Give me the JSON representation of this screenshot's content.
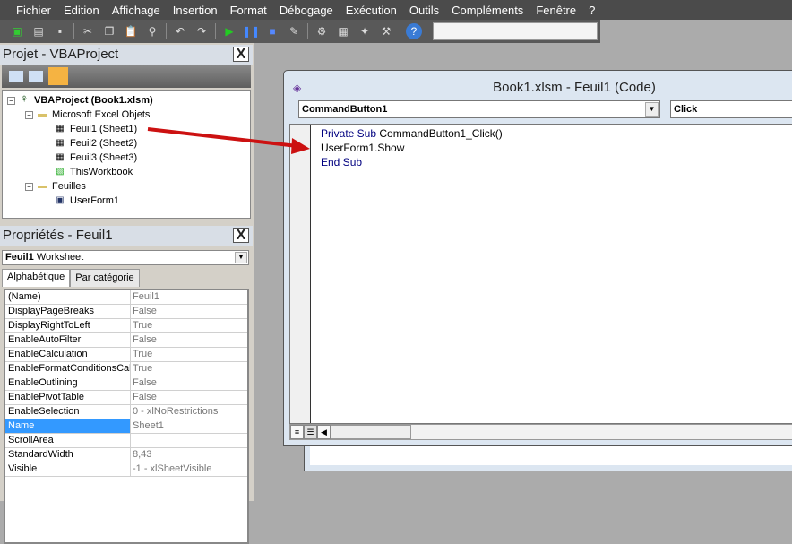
{
  "menu": [
    "Fichier",
    "Edition",
    "Affichage",
    "Insertion",
    "Format",
    "Débogage",
    "Exécution",
    "Outils",
    "Compléments",
    "Fenêtre",
    "?"
  ],
  "toolbar_icons": [
    "excel-icon",
    "insert-form-icon",
    "save-icon",
    "cut-icon",
    "copy-icon",
    "paste-icon",
    "find-icon",
    "undo-icon",
    "redo-icon",
    "run-icon",
    "pause-icon",
    "stop-icon",
    "design-mode-icon",
    "project-explorer-icon",
    "properties-icon",
    "object-browser-icon",
    "toolbox-icon",
    "help-icon"
  ],
  "project": {
    "title": "Projet - VBAProject",
    "close": "X",
    "tree": [
      {
        "label": "VBAProject (Book1.xlsm)",
        "level": 0,
        "bold": true,
        "toggle": "−",
        "icon": "vba-project-icon"
      },
      {
        "label": "Microsoft Excel Objets",
        "level": 1,
        "toggle": "−",
        "icon": "folder-icon"
      },
      {
        "label": "Feuil1 (Sheet1)",
        "level": 2,
        "icon": "sheet-icon"
      },
      {
        "label": "Feuil2 (Sheet2)",
        "level": 2,
        "icon": "sheet-icon"
      },
      {
        "label": "Feuil3 (Sheet3)",
        "level": 2,
        "icon": "sheet-icon"
      },
      {
        "label": "ThisWorkbook",
        "level": 2,
        "icon": "workbook-icon"
      },
      {
        "label": "Feuilles",
        "level": 1,
        "toggle": "−",
        "icon": "folder-icon"
      },
      {
        "label": "UserForm1",
        "level": 2,
        "icon": "userform-icon"
      }
    ]
  },
  "properties": {
    "title": "Propriétés - Feuil1",
    "close": "X",
    "object_name": "Feuil1",
    "object_type": "Worksheet",
    "tabs": [
      "Alphabétique",
      "Par catégorie"
    ],
    "rows": [
      [
        "(Name)",
        "Feuil1"
      ],
      [
        "DisplayPageBreaks",
        "False"
      ],
      [
        "DisplayRightToLeft",
        "True"
      ],
      [
        "EnableAutoFilter",
        "False"
      ],
      [
        "EnableCalculation",
        "True"
      ],
      [
        "EnableFormatConditionsCalculation",
        "True"
      ],
      [
        "EnableOutlining",
        "False"
      ],
      [
        "EnablePivotTable",
        "False"
      ],
      [
        "EnableSelection",
        "0 - xlNoRestrictions"
      ],
      [
        "Name",
        "Sheet1"
      ],
      [
        "ScrollArea",
        ""
      ],
      [
        "StandardWidth",
        "8,43"
      ],
      [
        "Visible",
        "-1 - xlSheetVisible"
      ]
    ],
    "selected_row": "Name"
  },
  "code_window": {
    "title": "Book1.xlsm - Feuil1 (Code)",
    "object_combo": "CommandButton1",
    "proc_combo": "Click",
    "lines": [
      {
        "kw": "Private Sub",
        "rest": " CommandButton1_Click()"
      },
      {
        "kw": "",
        "rest": "UserForm1.Show"
      },
      {
        "kw": "End Sub",
        "rest": ""
      }
    ]
  },
  "colors": {
    "keyword": "#000080",
    "selection": "#3399ff",
    "arrow": "#cc1111"
  }
}
